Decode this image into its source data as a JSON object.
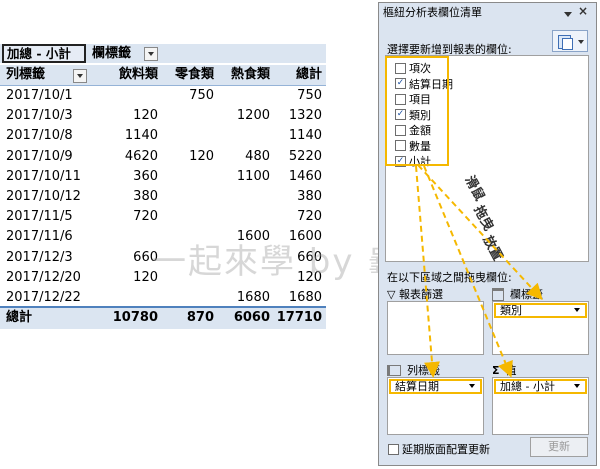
{
  "pivot": {
    "corner_label": "加總 - 小計",
    "column_labels_header": "欄標籤",
    "row_labels_header": "列標籤",
    "columns": [
      "飲料類",
      "零食類",
      "熱食類",
      "總計"
    ],
    "rows": [
      {
        "label": "2017/10/1",
        "values": [
          "",
          "750",
          "",
          "750"
        ]
      },
      {
        "label": "2017/10/3",
        "values": [
          "120",
          "",
          "1200",
          "1320"
        ]
      },
      {
        "label": "2017/10/8",
        "values": [
          "1140",
          "",
          "",
          "1140"
        ]
      },
      {
        "label": "2017/10/9",
        "values": [
          "4620",
          "120",
          "480",
          "5220"
        ]
      },
      {
        "label": "2017/10/11",
        "values": [
          "360",
          "",
          "1100",
          "1460"
        ]
      },
      {
        "label": "2017/10/12",
        "values": [
          "380",
          "",
          "",
          "380"
        ]
      },
      {
        "label": "2017/11/5",
        "values": [
          "720",
          "",
          "",
          "720"
        ]
      },
      {
        "label": "2017/11/6",
        "values": [
          "",
          "",
          "1600",
          "1600"
        ]
      },
      {
        "label": "2017/12/3",
        "values": [
          "660",
          "",
          "",
          "660"
        ]
      },
      {
        "label": "2017/12/20",
        "values": [
          "120",
          "",
          "",
          "120"
        ]
      },
      {
        "label": "2017/12/22",
        "values": [
          "",
          "",
          "1680",
          "1680"
        ]
      },
      {
        "label": "2017/12/31",
        "values": [
          "2660",
          "",
          "",
          "2660"
        ]
      }
    ],
    "total": {
      "label": "總計",
      "values": [
        "10780",
        "870",
        "6060",
        "17710"
      ]
    }
  },
  "watermark": "一起來學 by 龜小編",
  "field_list": {
    "title": "樞紐分析表欄位清單",
    "prompt": "選擇要新增到報表的欄位:",
    "fields": [
      {
        "label": "項次",
        "checked": false
      },
      {
        "label": "結算日期",
        "checked": true
      },
      {
        "label": "項目",
        "checked": false
      },
      {
        "label": "類別",
        "checked": true
      },
      {
        "label": "金額",
        "checked": false
      },
      {
        "label": "數量",
        "checked": false
      },
      {
        "label": "小計",
        "checked": true
      }
    ],
    "areas_prompt": "在以下區域之間拖曳欄位:",
    "report_filter": "報表篩選",
    "column_labels": "欄標籤",
    "row_labels": "列標籤",
    "values": "值",
    "column_chip": "類別",
    "row_chip": "結算日期",
    "values_chip": "加總 - 小計",
    "defer_update": "延期版面配置更新",
    "update_button": "更新"
  },
  "annotation": {
    "drag_words": [
      "滑鼠",
      "拖曳",
      "放置"
    ],
    "highlight_color": "#f5b800"
  }
}
